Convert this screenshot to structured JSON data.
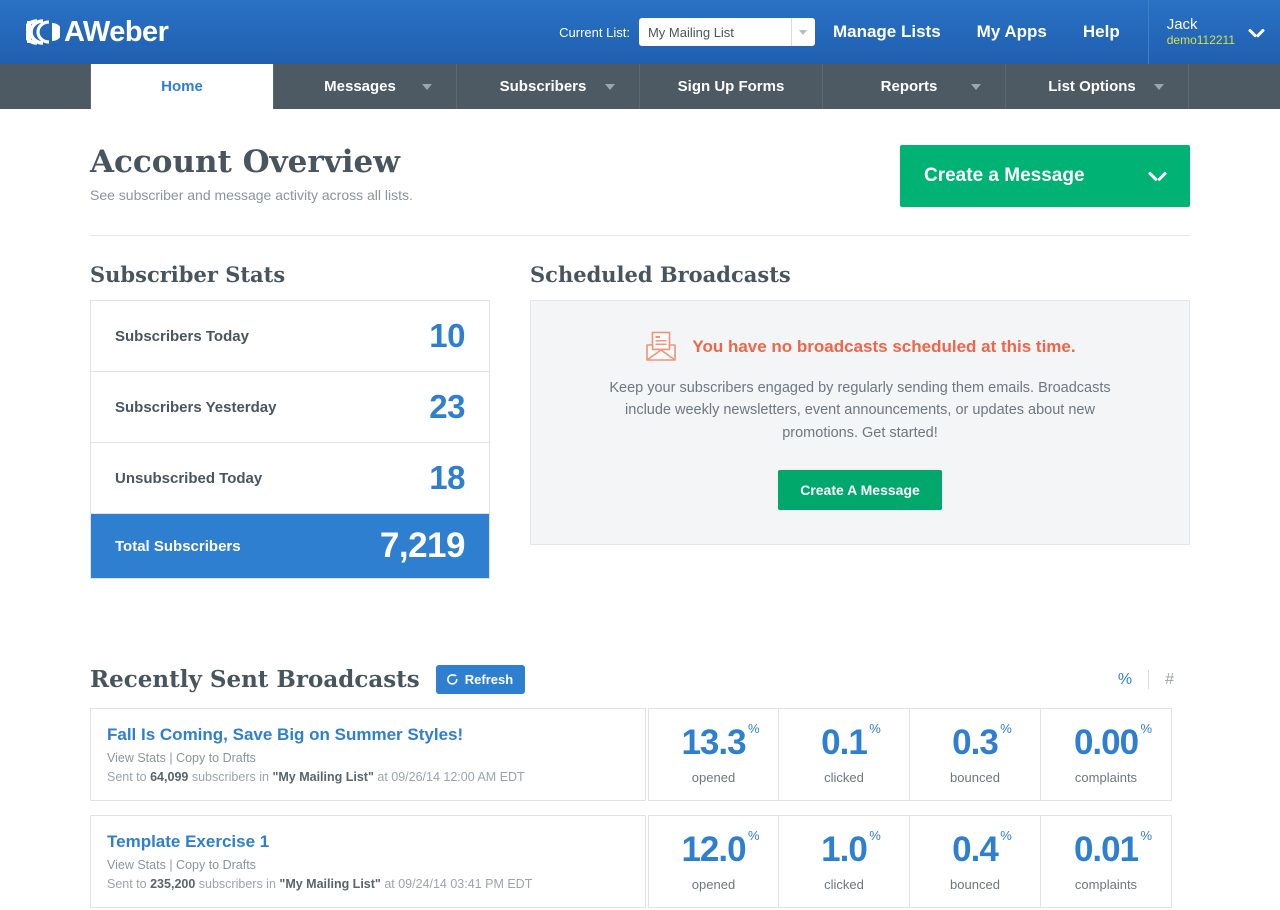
{
  "header": {
    "logo_text": "AWeber",
    "current_list_label": "Current List:",
    "current_list_value": "My Mailing List",
    "nav": [
      {
        "label": "Manage Lists"
      },
      {
        "label": "My Apps"
      },
      {
        "label": "Help"
      }
    ],
    "user": {
      "name": "Jack",
      "handle": "demo112211"
    }
  },
  "mainnav": [
    {
      "label": "Home",
      "active": true,
      "chevron": false
    },
    {
      "label": "Messages",
      "active": false,
      "chevron": true
    },
    {
      "label": "Subscribers",
      "active": false,
      "chevron": true
    },
    {
      "label": "Sign Up Forms",
      "active": false,
      "chevron": false
    },
    {
      "label": "Reports",
      "active": false,
      "chevron": true
    },
    {
      "label": "List Options",
      "active": false,
      "chevron": true
    }
  ],
  "overview": {
    "title": "Account Overview",
    "subtitle": "See subscriber and message activity across all lists.",
    "cta_label": "Create a Message"
  },
  "subscriber_stats": {
    "title": "Subscriber Stats",
    "rows": [
      {
        "label": "Subscribers Today",
        "value": "10",
        "total": false
      },
      {
        "label": "Subscribers Yesterday",
        "value": "23",
        "total": false
      },
      {
        "label": "Unsubscribed Today",
        "value": "18",
        "total": false
      },
      {
        "label": "Total Subscribers",
        "value": "7,219",
        "total": true
      }
    ]
  },
  "scheduled_broadcasts": {
    "title": "Scheduled Broadcasts",
    "empty_title": "You have no broadcasts scheduled at this time.",
    "empty_body": "Keep your subscribers engaged by regularly sending them emails. Broadcasts include weekly newsletters, event announcements, or updates about new promotions. Get started!",
    "empty_button": "Create A Message",
    "icon": "envelope-letter-icon"
  },
  "recently_sent": {
    "title": "Recently Sent Broadcasts",
    "refresh_label": "Refresh",
    "unit_percent": "%",
    "unit_number": "#",
    "active_unit": "%",
    "metric_labels": [
      "opened",
      "clicked",
      "bounced",
      "complaints"
    ],
    "rows": [
      {
        "title": "Fall Is Coming, Save Big on Summer Styles!",
        "view_stats": "View Stats",
        "separator": "|",
        "copy_to_drafts": "Copy to Drafts",
        "sent_prefix": "Sent to",
        "count": "64,099",
        "sent_mid": "subscribers in",
        "list": "\"My Mailing List\"",
        "sent_suffix": "at 09/26/14 12:00 AM EDT",
        "metrics": [
          {
            "value": "13.3",
            "unit": "%",
            "label": "opened"
          },
          {
            "value": "0.1",
            "unit": "%",
            "label": "clicked"
          },
          {
            "value": "0.3",
            "unit": "%",
            "label": "bounced"
          },
          {
            "value": "0.00",
            "unit": "%",
            "label": "complaints"
          }
        ]
      },
      {
        "title": "Template Exercise 1",
        "view_stats": "View Stats",
        "separator": "|",
        "copy_to_drafts": "Copy to Drafts",
        "sent_prefix": "Sent to",
        "count": "235,200",
        "sent_mid": "subscribers in",
        "list": "\"My Mailing List\"",
        "sent_suffix": "at 09/24/14 03:41 PM EDT",
        "metrics": [
          {
            "value": "12.0",
            "unit": "%",
            "label": "opened"
          },
          {
            "value": "1.0",
            "unit": "%",
            "label": "clicked"
          },
          {
            "value": "0.4",
            "unit": "%",
            "label": "bounced"
          },
          {
            "value": "0.01",
            "unit": "%",
            "label": "complaints"
          }
        ]
      }
    ]
  },
  "colors": {
    "header_blue": "#2264b5",
    "nav_slate": "#4d5a63",
    "accent_blue": "#2f7fd0",
    "green": "#00b374",
    "orange": "#f0654a",
    "handle_yellow": "#d5e04a"
  }
}
